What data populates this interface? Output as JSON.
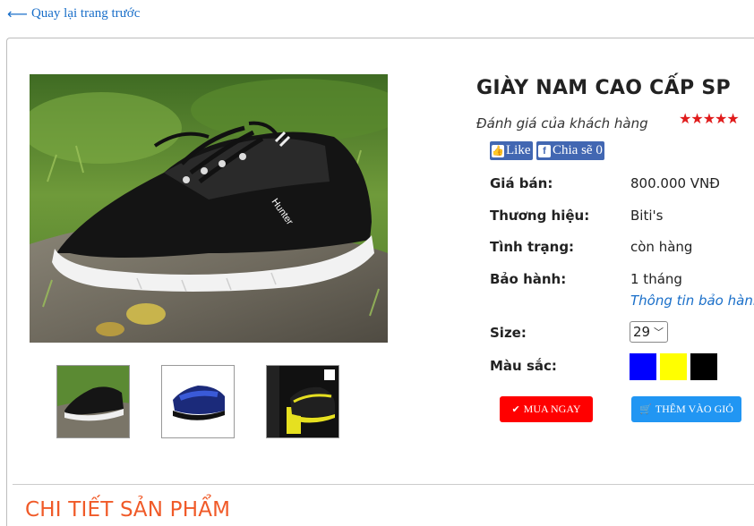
{
  "nav": {
    "back_label": "Quay lại trang trước",
    "back_icon": "arrow-left-icon"
  },
  "product": {
    "title": "GIÀY NAM CAO CẤP SP",
    "review_label": "Đánh giá của khách hàng",
    "stars": "★★★★★",
    "rating": 5,
    "rating_max": 5
  },
  "social": {
    "like_label": "Like",
    "share_label": "Chia sẽ 0",
    "color": "#4267b2"
  },
  "specs": [
    {
      "label": "Giá bán:",
      "value": "800.000 VNĐ"
    },
    {
      "label": "Thương hiệu:",
      "value": "Biti's"
    },
    {
      "label": "Tình trạng:",
      "value": "còn hàng"
    },
    {
      "label": "Bảo hành:",
      "value": "1 tháng"
    }
  ],
  "warranty_link": "Thông tin bảo hành",
  "size": {
    "label": "Size:",
    "selected": "29"
  },
  "colors": {
    "label": "Màu sắc:",
    "options": [
      "#0000ff",
      "#ffff00",
      "#000000"
    ]
  },
  "actions": {
    "buy_label": "MUA NGAY",
    "buy_icon": "check-icon",
    "buy_color": "#ff0000",
    "cart_label": "THÊM VÀO GIỎ",
    "cart_icon": "cart-icon",
    "cart_color": "#2196f3"
  },
  "shoe_logo": "Hunter",
  "section_title": "CHI TIẾT SẢN PHẨM"
}
